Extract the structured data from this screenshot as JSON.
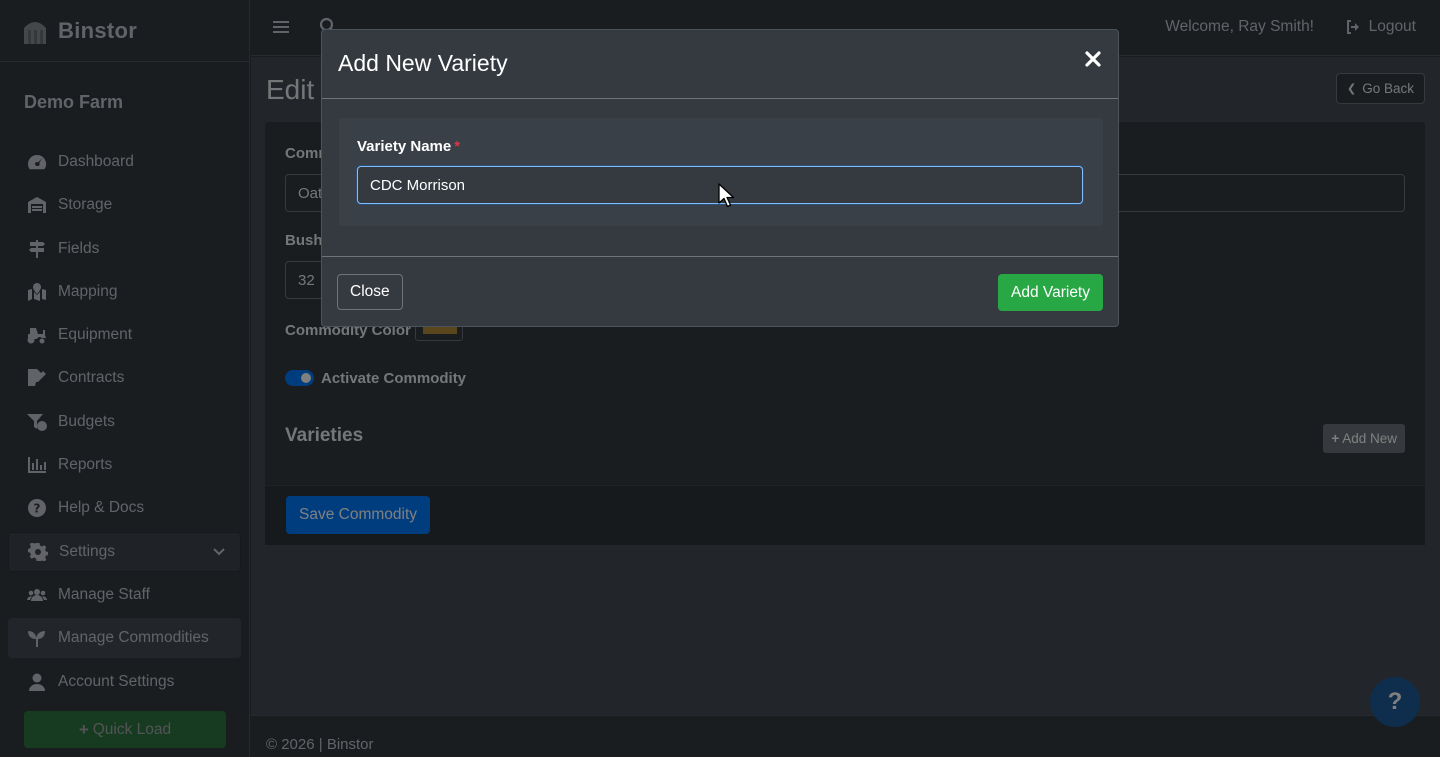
{
  "app": {
    "brand": "Binstor"
  },
  "sidebar": {
    "farm_name": "Demo Farm",
    "items": [
      {
        "label": "Dashboard",
        "icon": "tachometer-icon"
      },
      {
        "label": "Storage",
        "icon": "warehouse-icon"
      },
      {
        "label": "Fields",
        "icon": "signs-icon"
      },
      {
        "label": "Mapping",
        "icon": "map-marked-icon"
      },
      {
        "label": "Equipment",
        "icon": "tractor-icon"
      },
      {
        "label": "Contracts",
        "icon": "file-signature-icon"
      },
      {
        "label": "Budgets",
        "icon": "funnel-dollar-icon"
      },
      {
        "label": "Reports",
        "icon": "chart-bar-icon"
      },
      {
        "label": "Help & Docs",
        "icon": "question-circle-icon"
      },
      {
        "label": "Settings",
        "icon": "gear-icon"
      },
      {
        "label": "Manage Staff",
        "icon": "users-icon"
      },
      {
        "label": "Manage Commodities",
        "icon": "seedling-icon"
      },
      {
        "label": "Account Settings",
        "icon": "user-icon"
      }
    ],
    "quick_load": "Quick Load"
  },
  "topbar": {
    "welcome": "Welcome, Ray Smith!",
    "logout": "Logout"
  },
  "page": {
    "title": "Edit",
    "go_back": "Go Back",
    "commodity_label": "Comm",
    "commodity_value": "Oat",
    "bushel_label": "Bush",
    "bushel_value": "32",
    "color_label": "Commodity Color",
    "activate_label": "Activate Commodity",
    "varieties_title": "Varieties",
    "add_new": "Add New",
    "save_button": "Save Commodity"
  },
  "footer": {
    "text": "© 2026 | Binstor"
  },
  "help_fab": "?",
  "modal": {
    "title": "Add New Variety",
    "field_label": "Variety Name",
    "required_mark": "*",
    "field_value": "CDC Morrison",
    "close_button": "Close",
    "add_button": "Add Variety"
  },
  "colors": {
    "accent_blue": "#007bff",
    "success_green": "#28a745",
    "danger_red": "#dc3545",
    "bg_dark": "#343a40",
    "commodity_color": "#b58c3a"
  }
}
